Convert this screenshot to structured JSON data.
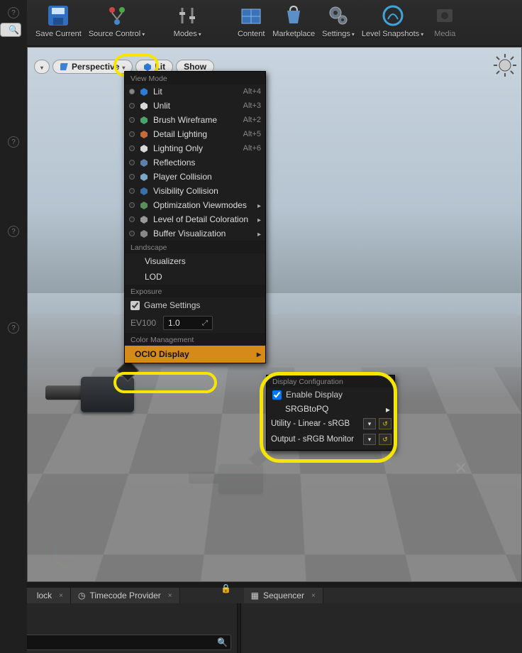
{
  "toolbar": {
    "save_current": "Save Current",
    "source_control": "Source Control",
    "modes": "Modes",
    "content": "Content",
    "marketplace": "Marketplace",
    "settings": "Settings",
    "level_snapshots": "Level Snapshots",
    "media": "Media"
  },
  "view_pills": {
    "perspective": "Perspective",
    "lit": "Lit",
    "show": "Show"
  },
  "menu": {
    "view_mode_header": "View Mode",
    "items": [
      {
        "label": "Lit",
        "shortcut": "Alt+4",
        "iconColor": "#2f7ad6",
        "selected": true
      },
      {
        "label": "Unlit",
        "shortcut": "Alt+3",
        "iconColor": "#d8d8d8",
        "selected": false
      },
      {
        "label": "Brush Wireframe",
        "shortcut": "Alt+2",
        "iconColor": "#4aa36a",
        "selected": false
      },
      {
        "label": "Detail Lighting",
        "shortcut": "Alt+5",
        "iconColor": "#c96a3a",
        "selected": false
      },
      {
        "label": "Lighting Only",
        "shortcut": "Alt+6",
        "iconColor": "#d8d8d8",
        "selected": false
      },
      {
        "label": "Reflections",
        "shortcut": "",
        "iconColor": "#5f7fa8",
        "selected": false
      },
      {
        "label": "Player Collision",
        "shortcut": "",
        "iconColor": "#7aa8c6",
        "selected": false
      },
      {
        "label": "Visibility Collision",
        "shortcut": "",
        "iconColor": "#3a6fa8",
        "selected": false
      },
      {
        "label": "Optimization Viewmodes",
        "shortcut": "",
        "iconColor": "#5a8f5a",
        "submenu": true,
        "selected": false
      },
      {
        "label": "Level of Detail Coloration",
        "shortcut": "",
        "iconColor": "#999999",
        "submenu": true,
        "selected": false
      },
      {
        "label": "Buffer Visualization",
        "shortcut": "",
        "iconColor": "#888888",
        "submenu": true,
        "selected": false
      }
    ],
    "landscape_header": "Landscape",
    "visualizers": "Visualizers",
    "lod": "LOD",
    "exposure_header": "Exposure",
    "game_settings": "Game Settings",
    "ev100_label": "EV100",
    "ev100_value": "1.0",
    "color_mgmt_header": "Color Management",
    "ocio_display": "OCIO Display"
  },
  "submenu": {
    "header": "Display Configuration",
    "enable_display": "Enable Display",
    "srgb_to_pq": "SRGBtoPQ",
    "source": "Utility - Linear - sRGB",
    "output": "Output - sRGB Monitor"
  },
  "bottom": {
    "tab_unlock": "lock",
    "tab_timecode": "Timecode Provider",
    "tab_sequencer": "Sequencer"
  },
  "icons": {
    "search": "🔍",
    "help": "?",
    "lock": "🔒",
    "clock": "◷",
    "film": "▦"
  }
}
